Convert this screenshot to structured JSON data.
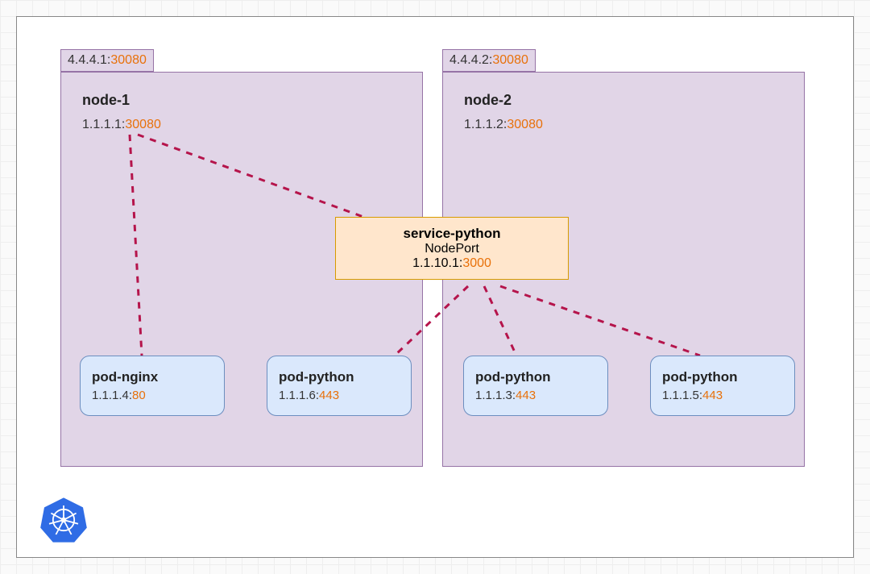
{
  "node1": {
    "tab_ip": "4.4.4.1:",
    "tab_port": "30080",
    "title": "node-1",
    "ip": "1.1.1.1:",
    "port": "30080"
  },
  "node2": {
    "tab_ip": "4.4.4.2:",
    "tab_port": "30080",
    "title": "node-2",
    "ip": "1.1.1.2:",
    "port": "30080"
  },
  "service": {
    "title": "service-python",
    "type": "NodePort",
    "ip": "1.1.10.1:",
    "port": "3000"
  },
  "pods": {
    "p0": {
      "title": "pod-nginx",
      "ip": "1.1.1.4:",
      "port": "80"
    },
    "p1": {
      "title": "pod-python",
      "ip": "1.1.1.6:",
      "port": "443"
    },
    "p2": {
      "title": "pod-python",
      "ip": "1.1.1.3:",
      "port": "443"
    },
    "p3": {
      "title": "pod-python",
      "ip": "1.1.1.5:",
      "port": "443"
    }
  },
  "colors": {
    "dash": "#b5144b"
  }
}
